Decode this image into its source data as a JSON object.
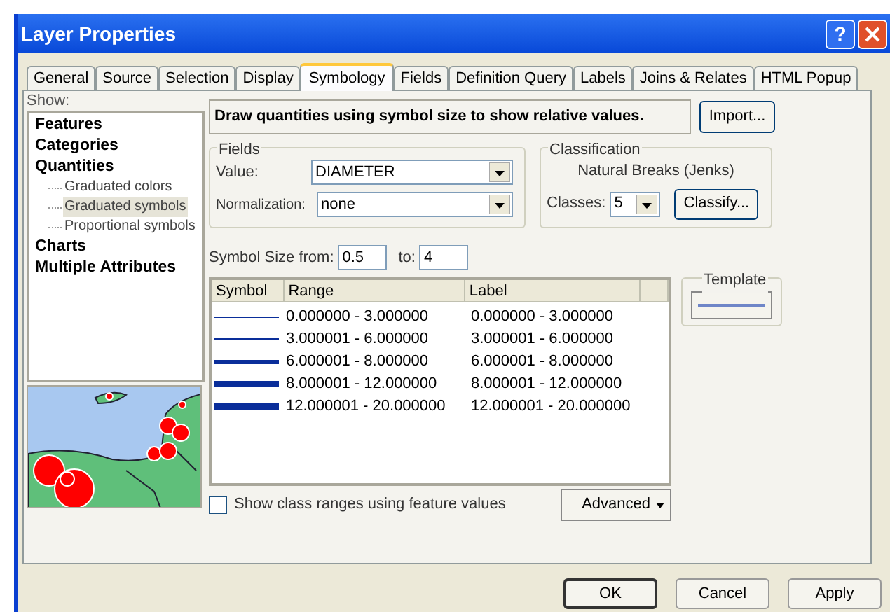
{
  "window": {
    "title": "Layer Properties",
    "help": "?"
  },
  "tabs": [
    {
      "label": "General",
      "selected": false
    },
    {
      "label": "Source",
      "selected": false
    },
    {
      "label": "Selection",
      "selected": false
    },
    {
      "label": "Display",
      "selected": false
    },
    {
      "label": "Symbology",
      "selected": true
    },
    {
      "label": "Fields",
      "selected": false
    },
    {
      "label": "Definition Query",
      "selected": false
    },
    {
      "label": "Labels",
      "selected": false
    },
    {
      "label": "Joins & Relates",
      "selected": false
    },
    {
      "label": "HTML Popup",
      "selected": false
    }
  ],
  "show": {
    "label": "Show:",
    "items": [
      {
        "label": "Features",
        "selected": false
      },
      {
        "label": "Categories",
        "selected": false
      },
      {
        "label": "Quantities",
        "selected": false,
        "children": [
          {
            "label": "Graduated colors",
            "selected": false
          },
          {
            "label": "Graduated symbols",
            "selected": true
          },
          {
            "label": "Proportional symbols",
            "selected": false
          }
        ]
      },
      {
        "label": "Charts",
        "selected": false
      },
      {
        "label": "Multiple Attributes",
        "selected": false
      }
    ]
  },
  "description": "Draw quantities using symbol size to show relative values.",
  "import_button": "Import...",
  "fields": {
    "title": "Fields",
    "value_label": "Value:",
    "value": "DIAMETER",
    "normalization_label": "Normalization:",
    "normalization": "none"
  },
  "classification": {
    "title": "Classification",
    "method": "Natural Breaks (Jenks)",
    "classes_label": "Classes:",
    "classes": "5",
    "classify_button": "Classify..."
  },
  "symbol_size": {
    "from_label": "Symbol Size from:",
    "from": "0.5",
    "to_label": "to:",
    "to": "4"
  },
  "table": {
    "columns": [
      "Symbol",
      "Range",
      "Label"
    ],
    "rows": [
      {
        "range": "0.000000 - 3.000000",
        "label": "0.000000 - 3.000000"
      },
      {
        "range": "3.000001 - 6.000000",
        "label": "3.000001 - 6.000000"
      },
      {
        "range": "6.000001 - 8.000000",
        "label": "6.000001 - 8.000000"
      },
      {
        "range": "8.000001 - 12.000000",
        "label": "8.000001 - 12.000000"
      },
      {
        "range": "12.000001 - 20.000000",
        "label": "12.000001 - 20.000000"
      }
    ]
  },
  "template": {
    "title": "Template"
  },
  "show_class_ranges": {
    "label": "Show class ranges using feature values",
    "checked": false
  },
  "advanced_button": "Advanced",
  "buttons": [
    "OK",
    "Cancel",
    "Apply"
  ]
}
